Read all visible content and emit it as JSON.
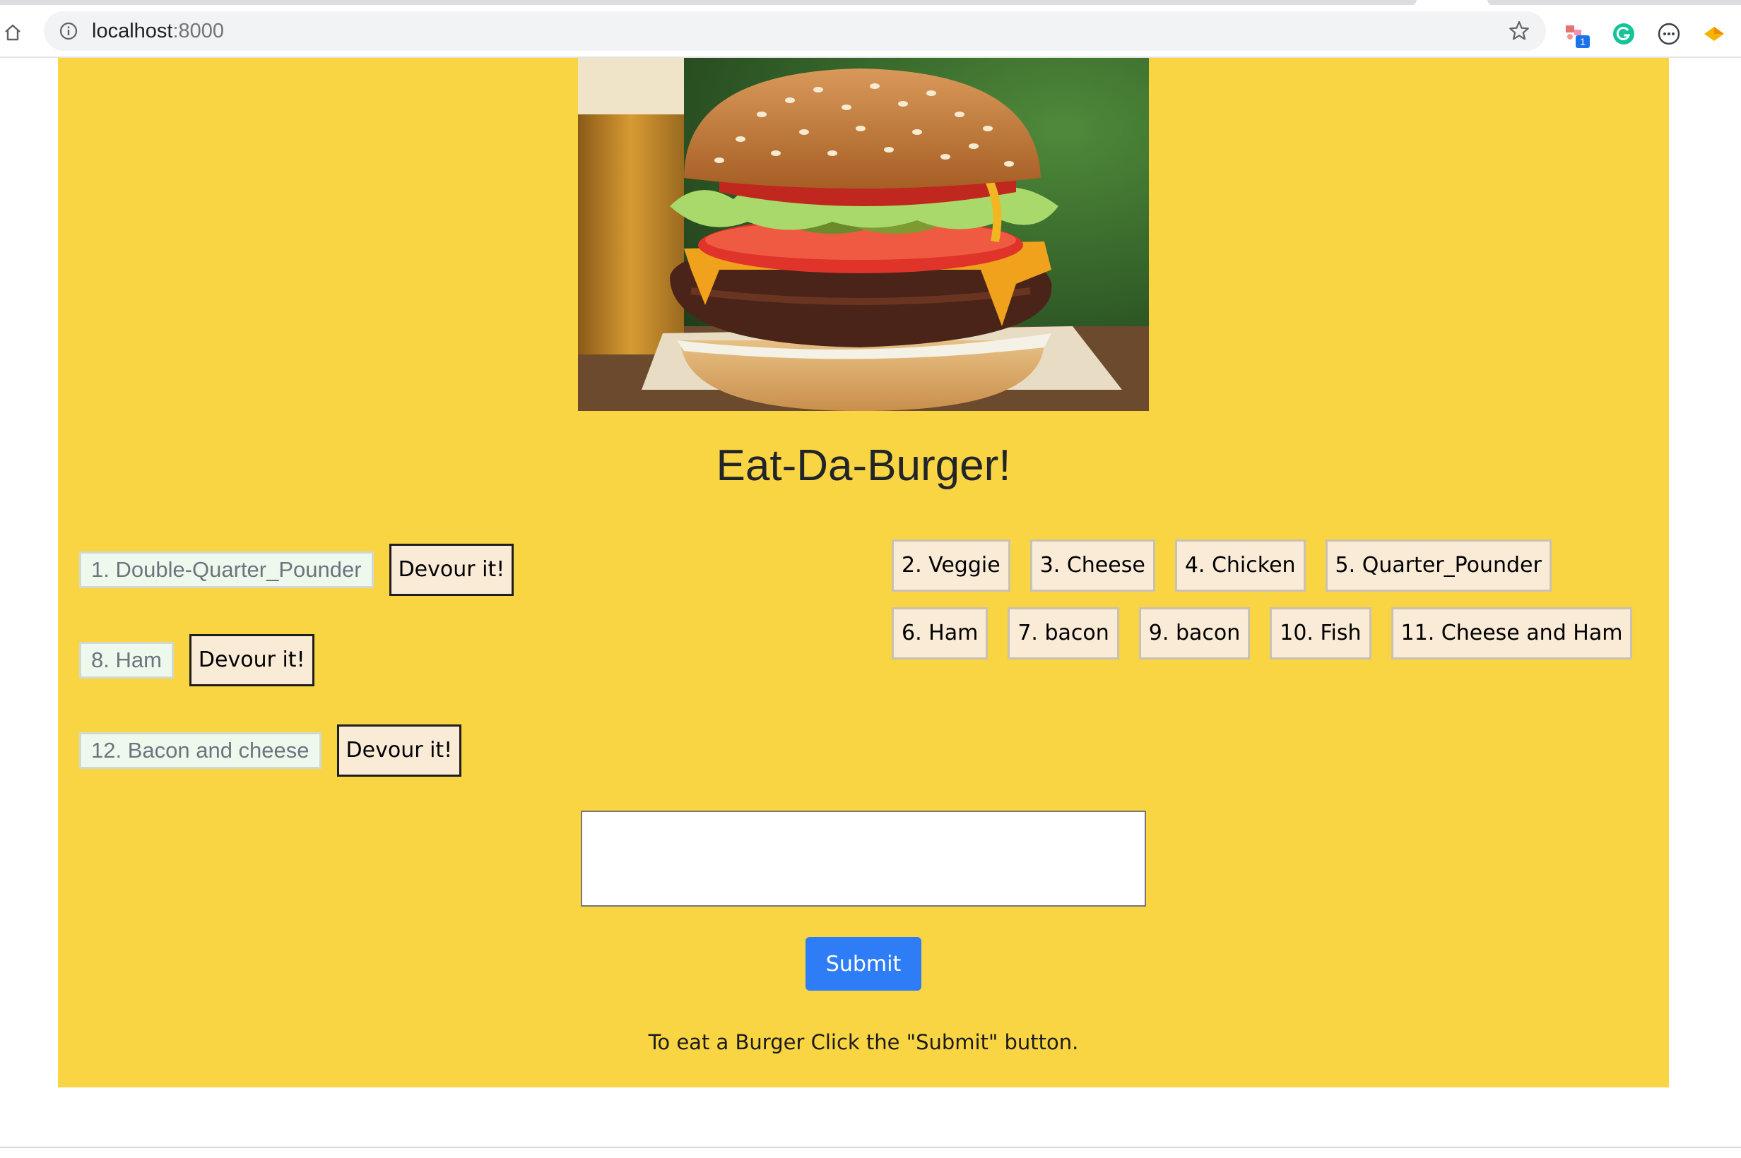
{
  "browser": {
    "url_host": "localhost",
    "url_port": ":8000",
    "extension_badge": "1"
  },
  "page": {
    "title": "Eat-Da-Burger!",
    "accent_color": "#f9d443",
    "submit_color": "#2f7df6"
  },
  "not_devoured": [
    {
      "name": "1. Double-Quarter_Pounder",
      "button": "Devour it!"
    },
    {
      "name": "8. Ham",
      "button": "Devour it!"
    },
    {
      "name": "12. Bacon and cheese",
      "button": "Devour it!"
    }
  ],
  "devoured_rows": [
    [
      "2. Veggie",
      "3. Cheese",
      "4. Chicken",
      "5. Quarter_Pounder"
    ],
    [
      "6. Ham",
      "7. bacon",
      "9. bacon",
      "10. Fish",
      "11. Cheese and Ham"
    ]
  ],
  "form": {
    "input_value": "",
    "submit_label": "Submit",
    "hint": "To eat a Burger Click the \"Submit\" button."
  }
}
